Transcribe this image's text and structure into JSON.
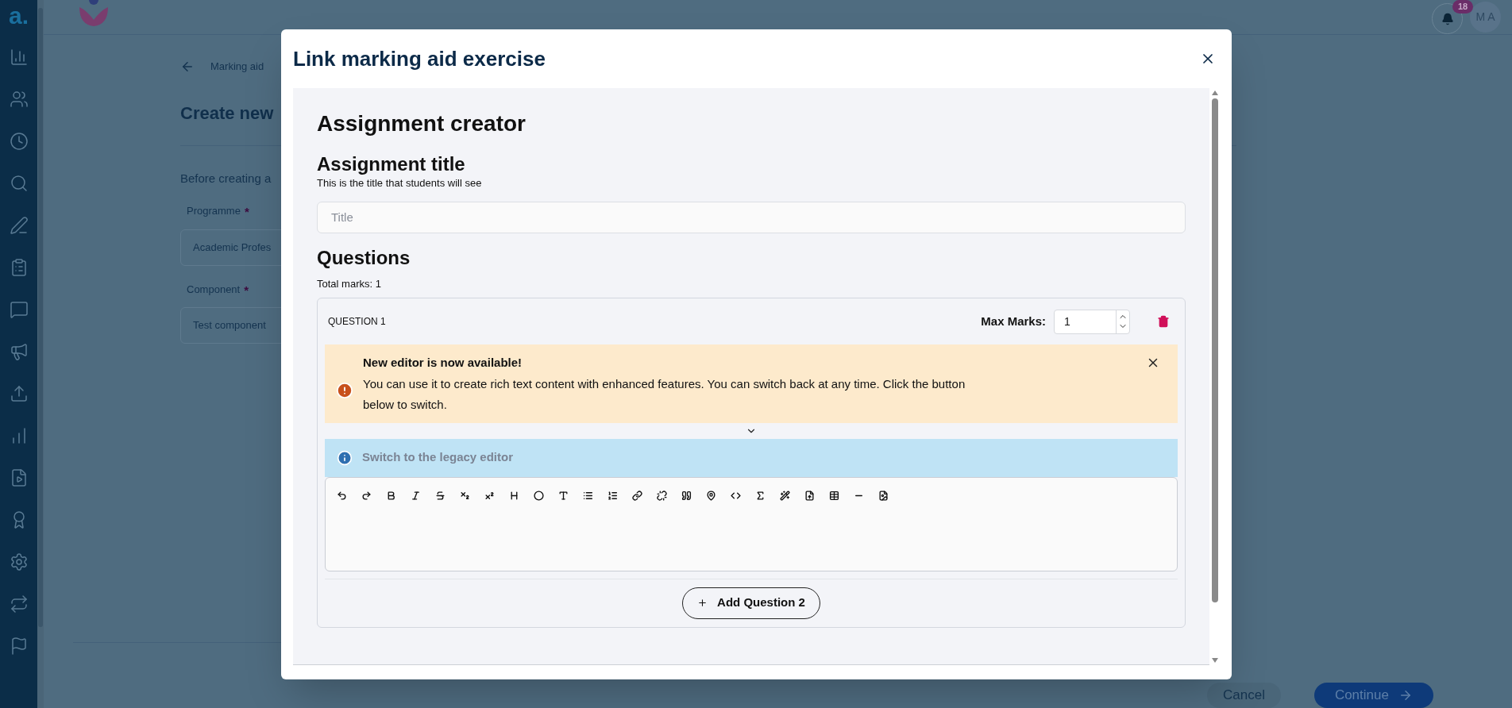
{
  "app": {
    "logo": "a.",
    "notification_count": "18",
    "avatar": "M A"
  },
  "page": {
    "breadcrumb": "Marking aid",
    "title": "Create new",
    "intro": "Before creating a",
    "fields": [
      {
        "label": "Programme",
        "required_mark": "*",
        "value": "Academic Profes"
      },
      {
        "label": "Component",
        "required_mark": "*",
        "value": "Test component"
      }
    ],
    "cancel": "Cancel",
    "continue": "Continue"
  },
  "dialog": {
    "title": "Link marking aid exercise",
    "heading": "Assignment creator",
    "assignment_title": {
      "label": "Assignment title",
      "hint": "This is the title that students will see",
      "placeholder": "Title"
    },
    "questions": {
      "heading": "Questions",
      "total": "Total marks: 1",
      "items": [
        {
          "label": "QUESTION 1",
          "max_marks_label": "Max Marks:",
          "max_marks": "1",
          "alert": {
            "title": "New editor is now available!",
            "message": "You can use it to create rich text content with enhanced features. You can switch back at any time. Click the button below to switch."
          },
          "legacy_link": "Switch to the legacy editor"
        }
      ],
      "add_button": "Add Question 2"
    }
  }
}
